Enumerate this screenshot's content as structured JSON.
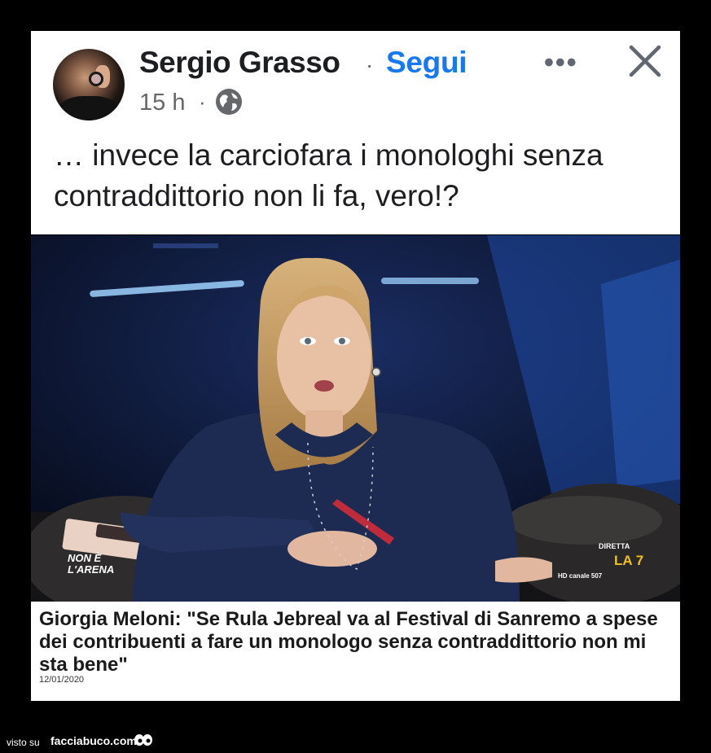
{
  "post": {
    "author": "Sergio Grasso",
    "separator": "·",
    "follow_label": "Segui",
    "more_label": "•••",
    "time": "15 h",
    "time_separator": "·",
    "text": "… invece la carciofara i monologhi senza contraddittorio non li fa, vero!?"
  },
  "image": {
    "overlay_logo": "NON È L'ARENA",
    "channel_label": "DIRETTA",
    "channel_name": "LA 7",
    "channel_sub": "HD canale 507",
    "caption": "Giorgia Meloni: \"Se Rula Jebreal va al Festival di Sanremo a spese dei contribuenti a fare un monologo senza contraddittorio non mi sta bene\"",
    "date": "12/01/2020"
  },
  "footer": {
    "label": "visto su",
    "site": "facciabuco.com"
  },
  "colors": {
    "follow": "#1877f2",
    "text": "#1c1e21",
    "meta": "#65676b"
  }
}
